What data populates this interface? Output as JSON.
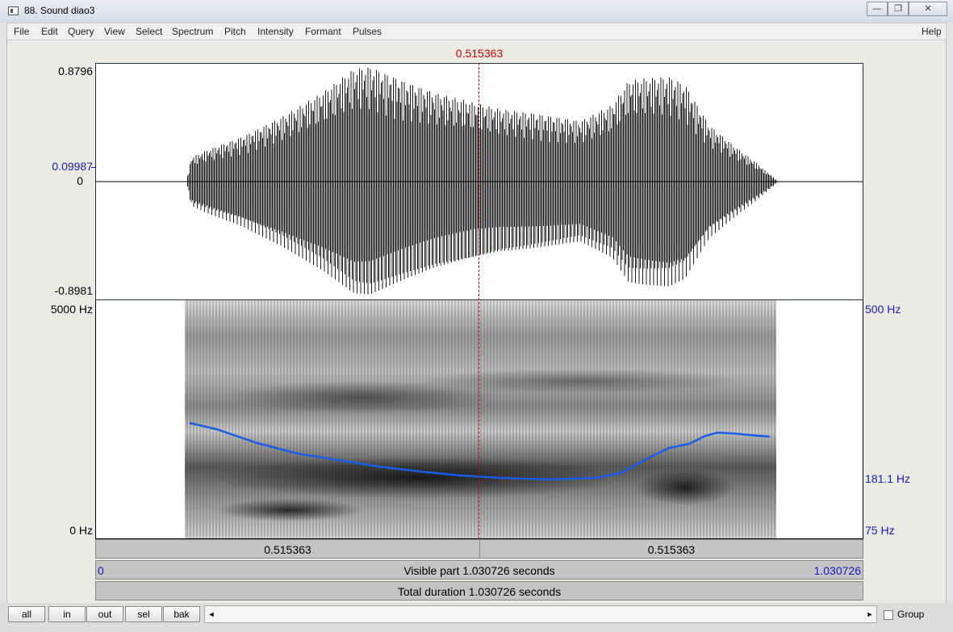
{
  "window": {
    "title": "88. Sound diao3",
    "minimize": "—",
    "restore": "❐",
    "close": "✕"
  },
  "menu": [
    "File",
    "Edit",
    "Query",
    "View",
    "Select",
    "Spectrum",
    "Pitch",
    "Intensity",
    "Formant",
    "Pulses"
  ],
  "help_label": "Help",
  "cursor_time": "0.515363",
  "waveform": {
    "max_label": "0.8796",
    "cursor_value_label": "0.09987",
    "zero_label": "0",
    "min_label": "-0.8981"
  },
  "spectrogram": {
    "top_freq": "5000 Hz",
    "bottom_freq": "0 Hz",
    "pitch_top": "500 Hz",
    "pitch_cursor": "181.1 Hz",
    "pitch_bottom": "75 Hz"
  },
  "time_bars": {
    "left_segment": "0.515363",
    "right_segment": "0.515363",
    "start": "0",
    "visible_part": "Visible part 1.030726 seconds",
    "end": "1.030726",
    "total_duration": "Total duration 1.030726 seconds"
  },
  "buttons": {
    "all": "all",
    "in": "in",
    "out": "out",
    "sel": "sel",
    "bak": "bak"
  },
  "scroll": {
    "left_arrow": "◄",
    "right_arrow": "►"
  },
  "group_label": "Group",
  "colors": {
    "cursor": "#d00000",
    "pitch_curve": "#1a5ce8",
    "axis_blue": "#1a1ac0"
  },
  "icons": [
    "window-icon",
    "minimize-icon",
    "restore-icon",
    "close-icon",
    "scroll-left-icon",
    "scroll-right-icon",
    "group-checkbox"
  ]
}
